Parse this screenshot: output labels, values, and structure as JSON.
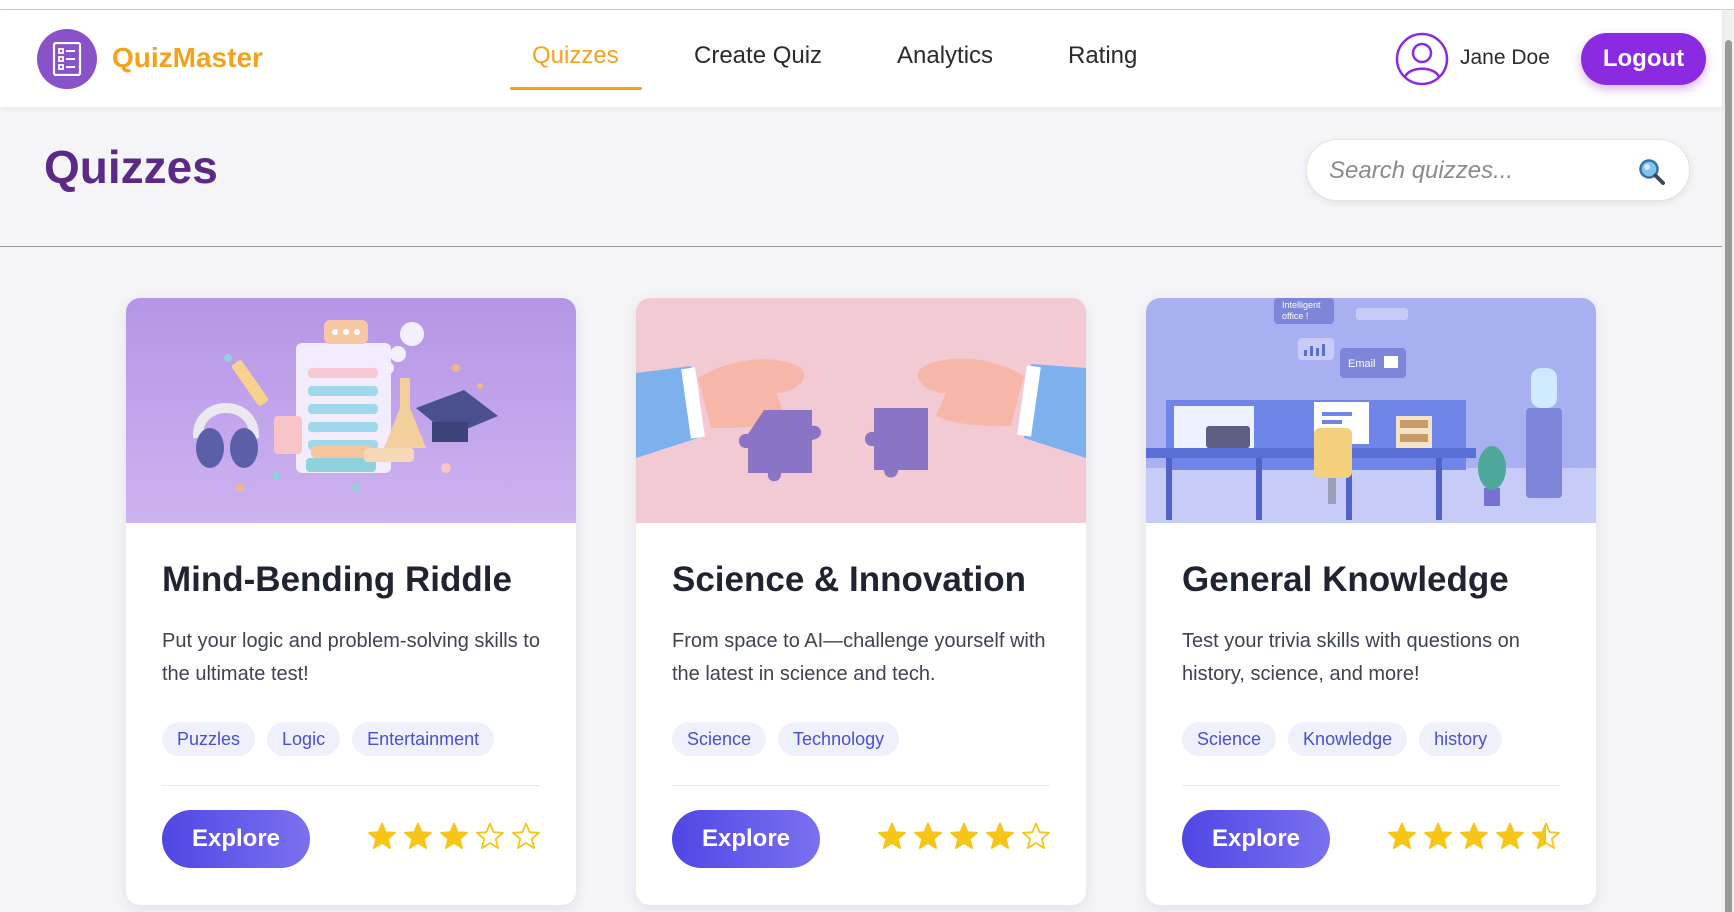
{
  "app": {
    "name": "QuizMaster",
    "logo_icon": "quiz-list-icon"
  },
  "nav": {
    "items": [
      {
        "label": "Quizzes",
        "active": true
      },
      {
        "label": "Create Quiz",
        "active": false
      },
      {
        "label": "Analytics",
        "active": false
      },
      {
        "label": "Rating",
        "active": false
      }
    ]
  },
  "user": {
    "name": "Jane Doe",
    "avatar_icon": "user-circle-icon",
    "logout_label": "Logout"
  },
  "page": {
    "title": "Quizzes"
  },
  "search": {
    "placeholder": "Search quizzes...",
    "value": "",
    "icon": "magnifier-icon"
  },
  "colors": {
    "brand_orange": "#f2a21d",
    "brand_purple": "#8a2be2",
    "title_purple": "#5a2a86",
    "explore_blue": "#5046e5",
    "tag_text": "#4b4fd0",
    "star_gold": "#f5c518"
  },
  "cards": [
    {
      "title": "Mind-Bending Riddle",
      "description": "Put your logic and problem-solving skills to the ultimate test!",
      "tags": [
        "Puzzles",
        "Logic",
        "Entertainment"
      ],
      "button_label": "Explore",
      "rating": 3,
      "image_theme": "education-illustration"
    },
    {
      "title": "Science & Innovation",
      "description": "From space to AI—challenge yourself with the latest in science and tech.",
      "tags": [
        "Science",
        "Technology"
      ],
      "button_label": "Explore",
      "rating": 4,
      "image_theme": "puzzle-hands-illustration"
    },
    {
      "title": "General Knowledge",
      "description": "Test your trivia skills with questions on history, science, and more!",
      "tags": [
        "Science",
        "Knowledge",
        "history"
      ],
      "button_label": "Explore",
      "rating": 4.5,
      "image_theme": "office-illustration",
      "image_texts": [
        "Intelligent office !",
        "Email"
      ]
    }
  ]
}
